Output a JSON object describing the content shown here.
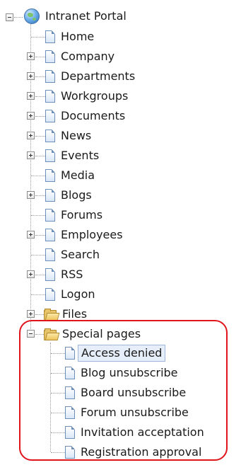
{
  "tree": {
    "root": {
      "label": "Intranet Portal",
      "icon": "globe-icon",
      "expanded": true
    },
    "children": [
      {
        "label": "Home",
        "icon": "page-icon",
        "expandable": false
      },
      {
        "label": "Company",
        "icon": "page-icon",
        "expandable": true
      },
      {
        "label": "Departments",
        "icon": "page-icon",
        "expandable": true
      },
      {
        "label": "Workgroups",
        "icon": "page-icon",
        "expandable": true
      },
      {
        "label": "Documents",
        "icon": "page-icon",
        "expandable": true
      },
      {
        "label": "News",
        "icon": "page-icon",
        "expandable": true
      },
      {
        "label": "Events",
        "icon": "page-icon",
        "expandable": true
      },
      {
        "label": "Media",
        "icon": "page-icon",
        "expandable": false
      },
      {
        "label": "Blogs",
        "icon": "page-icon",
        "expandable": true
      },
      {
        "label": "Forums",
        "icon": "page-icon",
        "expandable": false
      },
      {
        "label": "Employees",
        "icon": "page-icon",
        "expandable": true
      },
      {
        "label": "Search",
        "icon": "page-icon",
        "expandable": false
      },
      {
        "label": "RSS",
        "icon": "page-icon",
        "expandable": true
      },
      {
        "label": "Logon",
        "icon": "page-icon",
        "expandable": false
      },
      {
        "label": "Files",
        "icon": "folder-icon",
        "expandable": true
      },
      {
        "label": "Special pages",
        "icon": "folder-open-icon",
        "expandable": true,
        "expanded": true
      }
    ],
    "special_pages": [
      {
        "label": "Access denied",
        "icon": "page-icon",
        "selected": true
      },
      {
        "label": "Blog unsubscribe",
        "icon": "page-icon"
      },
      {
        "label": "Board unsubscribe",
        "icon": "page-icon"
      },
      {
        "label": "Forum unsubscribe",
        "icon": "page-icon"
      },
      {
        "label": "Invitation acceptation",
        "icon": "page-icon"
      },
      {
        "label": "Registration approval",
        "icon": "page-icon"
      }
    ]
  },
  "colors": {
    "highlight_border": "#e1141c",
    "selection_bg": "#e6eef9",
    "selection_border": "#9eb6d8",
    "connector": "#9a9a9a"
  }
}
